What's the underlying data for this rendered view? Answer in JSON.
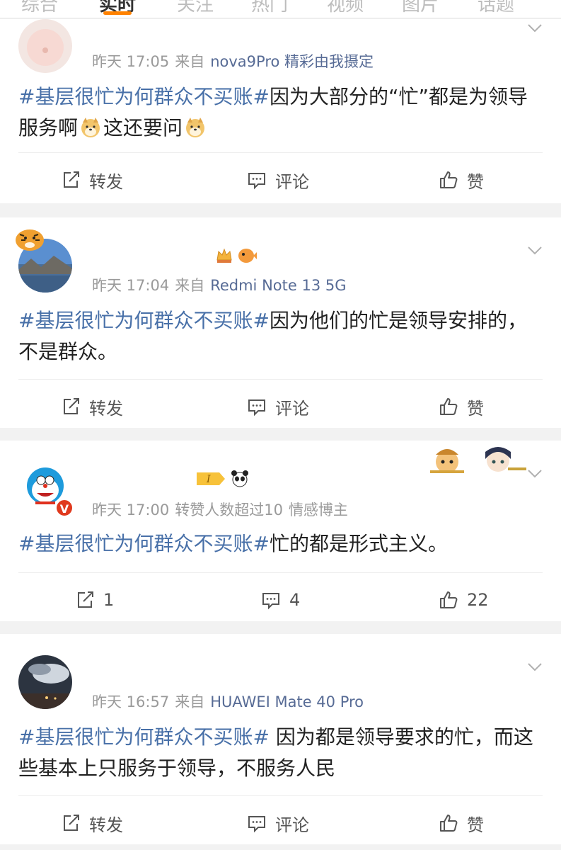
{
  "tabs": [
    "综合",
    "实时",
    "关注",
    "热门",
    "视频",
    "图片",
    "话题"
  ],
  "topic": "#基层很忙为何群众不买账#",
  "posts": [
    {
      "name": "",
      "time": "昨天 17:05",
      "source_prefix": "来自",
      "source": "nova9Pro 精彩由我摄定",
      "text_a": "因为大部分的“忙”都是为领导服务啊",
      "text_b": "这还要问",
      "actions": {
        "repost": "转发",
        "comment": "评论",
        "like": "赞"
      }
    },
    {
      "name": "",
      "time": "昨天 17:04",
      "source_prefix": "来自",
      "source": "Redmi Note 13 5G",
      "text": "因为他们的忙是领导安排的，不是群众。",
      "actions": {
        "repost": "转发",
        "comment": "评论",
        "like": "赞"
      }
    },
    {
      "name": "",
      "time": "昨天 17:00",
      "extra": "转赞人数超过10",
      "tag": "情感博主",
      "verified": "V",
      "text": "忙的都是形式主义。",
      "actions": {
        "repost": "1",
        "comment": "4",
        "like": "22"
      }
    },
    {
      "name": "",
      "time": "昨天 16:57",
      "source_prefix": "来自",
      "source": "HUAWEI Mate 40 Pro",
      "text": " 因为都是领导要求的忙，而这些基本上只服务于领导，不服务人民",
      "actions": {
        "repost": "转发",
        "comment": "评论",
        "like": "赞"
      }
    }
  ],
  "colors": {
    "topic": "#4870a8",
    "source": "#576b95",
    "accent": "#ff8200"
  },
  "icons": [
    "repost-icon",
    "comment-icon",
    "like-icon",
    "chevron-down-icon",
    "doge-emoji"
  ]
}
